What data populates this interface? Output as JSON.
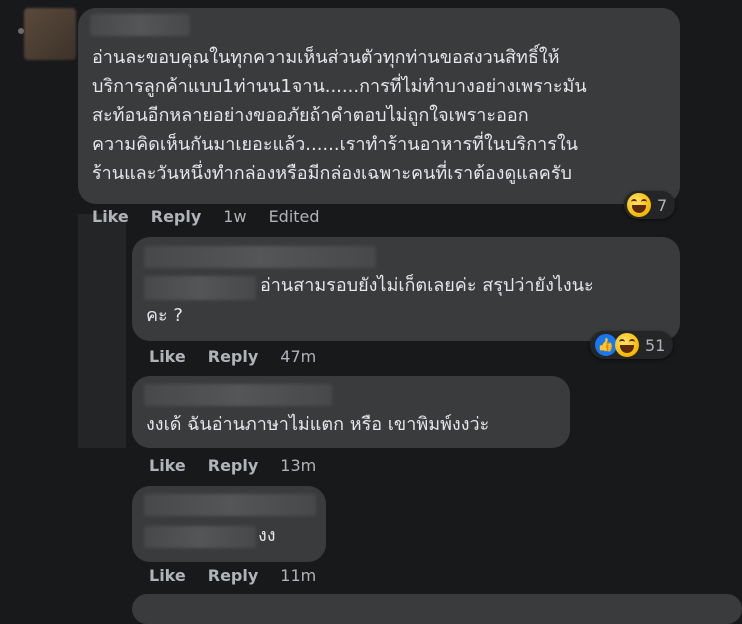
{
  "comments": [
    {
      "text_lines": [
        "อ่านละขอบคุณในทุกความเห็นส่วนตัวทุกท่านขอสงวนสิทธิ์ให้",
        "บริการลูกค้าแบบ1ท่านน1จาน......การที่ไม่ทำบางอย่างเพราะมัน",
        "สะท้อนอีกหลายอย่างขออภัยถ้าคำตอบไม่ถูกใจเพราะออก",
        "ความคิดเห็นกันมาเยอะแล้ว......เราทำร้านอาหารที่ในบริการใน",
        "ร้านและวันหนึ่งทำกล่องหรือมีกล่องเฉพาะคนที่เราต้องดูแลครับ"
      ],
      "like_label": "Like",
      "reply_label": "Reply",
      "time": "1w",
      "edited": "Edited",
      "reaction_count": "7",
      "reaction_icons": [
        "laughing-emoji"
      ]
    },
    {
      "text_lines": [
        "อ่านสามรอบยังไม่เก็ตเลยค่ะ สรุปว่ายังไงนะ",
        "คะ ?"
      ],
      "like_label": "Like",
      "reply_label": "Reply",
      "time": "47m",
      "reaction_count": "51",
      "reaction_icons": [
        "like-thumb",
        "laughing-emoji"
      ]
    },
    {
      "text_lines": [
        "งงเด้ ฉันอ่านภาษาไม่แตก หรือ เขาพิมพ์งงว่ะ"
      ],
      "like_label": "Like",
      "reply_label": "Reply",
      "time": "13m"
    },
    {
      "text_lines": [
        "งง"
      ],
      "like_label": "Like",
      "reply_label": "Reply",
      "time": "11m"
    }
  ],
  "colors": {
    "background": "#18191a",
    "bubble": "#3a3b3c",
    "text": "#e4e6eb",
    "muted": "#b0b3b8",
    "like_blue": "#1877f2"
  }
}
